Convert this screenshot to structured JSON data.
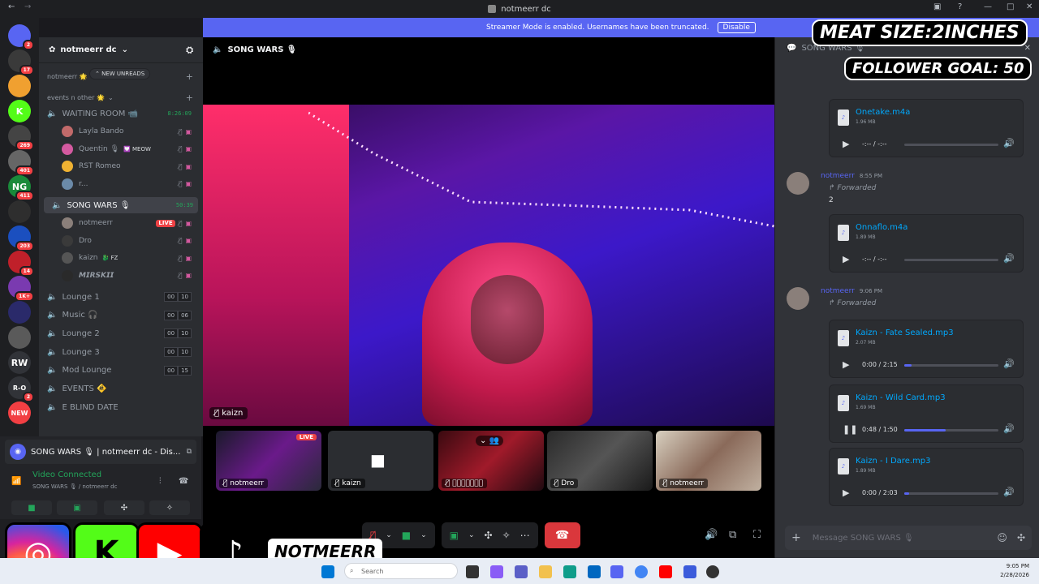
{
  "window": {
    "title": "notmeerr dc"
  },
  "banner": {
    "text": "Streamer Mode is enabled. Usernames have been truncated.",
    "button": "Disable"
  },
  "guilds": [
    {
      "badge": "2",
      "color": "#5865f2",
      "label": ""
    },
    {
      "badge": "17",
      "color": "#3a3a3a",
      "label": ""
    },
    {
      "badge": "",
      "color": "#f0a030",
      "label": ""
    },
    {
      "badge": "",
      "color": "#53fc18",
      "label": "K"
    },
    {
      "badge": "269",
      "color": "#444",
      "label": ""
    },
    {
      "badge": "401",
      "color": "#666",
      "label": ""
    },
    {
      "badge": "411",
      "color": "#1a8a3a",
      "label": "NG"
    },
    {
      "badge": "",
      "color": "#2e2e2e",
      "label": ""
    },
    {
      "badge": "203",
      "color": "#1b4fbf",
      "label": ""
    },
    {
      "badge": "14",
      "color": "#c0202a",
      "label": ""
    },
    {
      "badge": "1K+",
      "color": "#7a3ab0",
      "label": ""
    },
    {
      "badge": "",
      "color": "#2a2a6a",
      "label": ""
    },
    {
      "badge": "",
      "color": "#5a5a5a",
      "label": ""
    },
    {
      "badge": "",
      "color": "#313338",
      "label": "RW"
    },
    {
      "badge": "2",
      "color": "#313338",
      "label": "R-O"
    },
    {
      "badge": "",
      "color": "#f23f43",
      "label": "NEW"
    }
  ],
  "server": {
    "name": "notmeerr dc"
  },
  "sidebar": {
    "top_category": "notmeerr 🌟",
    "new_unreads": "NEW UNREADS",
    "category": "events n other 🌟",
    "waiting_room": {
      "name": "WAITING ROOM 📹",
      "timer": "8:26:09"
    },
    "waiting_users": [
      {
        "name": "Layla Bando",
        "color": "#c26a6a"
      },
      {
        "name": "Quentin 🎙",
        "tag": "💟 MEOW",
        "color": "#d45aa0"
      },
      {
        "name": "RST Romeo",
        "color": "#f0b232"
      },
      {
        "name": "r...",
        "color": "#6b8aa8"
      }
    ],
    "song_wars": {
      "name": "SONG WARS 🎙",
      "timer": "50:39"
    },
    "song_users": [
      {
        "name": "notmeerr",
        "live": "LIVE",
        "color": "#8a7f7a"
      },
      {
        "name": "Dro",
        "color": "#3a3a3a"
      },
      {
        "name": "kaizn",
        "tag": "🐉 FZ",
        "color": "#555"
      },
      {
        "name": "𝙈𝙄𝙍𝙎𝙆𝙄𝙄",
        "color": "#2a2a2a"
      }
    ],
    "channels": [
      {
        "name": "Lounge 1",
        "a": "00",
        "b": "10"
      },
      {
        "name": "Music 🎧",
        "a": "00",
        "b": "06"
      },
      {
        "name": "Lounge 2",
        "a": "00",
        "b": "10"
      },
      {
        "name": "Lounge 3",
        "a": "00",
        "b": "10"
      },
      {
        "name": "Mod Lounge",
        "a": "00",
        "b": "15"
      },
      {
        "name": "EVENTS 🚸"
      },
      {
        "name": "E BLIND DATE"
      }
    ]
  },
  "voice_panel": {
    "title": "SONG WARS 🎙 | notmeerr dc - Dis...",
    "status": "Video Connected",
    "sub": "SONG WARS 🎙 / notmeerr dc"
  },
  "stage": {
    "title": "SONG WARS 🎙",
    "main_user": "kaizn",
    "tiles": [
      {
        "name": "notmeerr",
        "live": "LIVE"
      },
      {
        "name": "kaizn"
      },
      {
        "name": "𝙈𝙄𝙍𝙎𝙆𝙄𝙄"
      },
      {
        "name": "Dro"
      },
      {
        "name": "notmeerr"
      }
    ]
  },
  "chat": {
    "header": "SONG WARS 🎙",
    "messages": [
      {
        "author": "notmeerr",
        "time": "8:55 PM",
        "forwarded": "Forwarded",
        "text": "2"
      },
      {
        "author": "notmeerr",
        "time": "9:06 PM",
        "forwarded": "Forwarded",
        "text": ""
      }
    ],
    "attachments": [
      {
        "name": "Onetake.m4a",
        "size": "1.96 MB",
        "time": "-:-- / -:--",
        "progress": 0,
        "state": "paused"
      },
      {
        "name": "Onnaflo.m4a",
        "size": "1.89 MB",
        "time": "-:-- / -:--",
        "progress": 0,
        "state": "paused"
      },
      {
        "name": "Kaizn - Fate Sealed.mp3",
        "size": "2.07 MB",
        "time": "0:00 / 2:15",
        "progress": 0.08,
        "state": "paused"
      },
      {
        "name": "Kaizn - Wild Card.mp3",
        "size": "1.69 MB",
        "time": "0:48 / 1:50",
        "progress": 0.44,
        "state": "playing"
      },
      {
        "name": "Kaizn - I Dare.mp3",
        "size": "1.89 MB",
        "time": "0:00 / 2:03",
        "progress": 0.05,
        "state": "paused"
      }
    ],
    "input_placeholder": "Message SONG WARS 🎙"
  },
  "overlay": {
    "line1": "MEAT SIZE:2INCHES",
    "line2": "FOLLOWER GOAL: 50",
    "handle": "NOTMEERR"
  },
  "taskbar": {
    "search": "Search",
    "time": "9:05 PM",
    "date": "2/28/2026"
  },
  "colors": {
    "accent": "#5865f2",
    "live": "#ed4245",
    "connected": "#23a55a",
    "end_call": "#da373c"
  }
}
